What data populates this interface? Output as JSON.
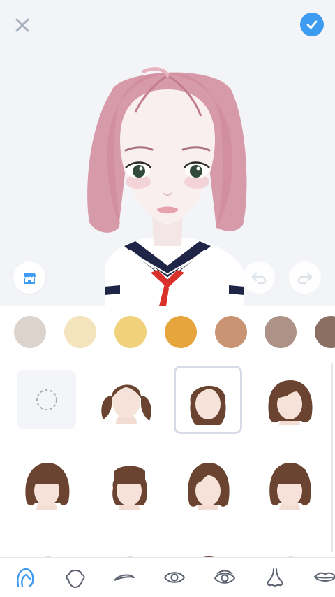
{
  "header": {
    "close_icon": "close-icon",
    "confirm_icon": "checkmark-icon",
    "confirm_color": "#3d9bf0"
  },
  "preview": {
    "store_icon": "store-icon",
    "undo_icon": "undo-icon",
    "redo_icon": "redo-icon",
    "hair_color": "#d79aa8"
  },
  "hair_colors": [
    "#dcd3cd",
    "#f3e4bd",
    "#f0d27c",
    "#e7a53d",
    "#c99473",
    "#ad9287",
    "#8c6f63"
  ],
  "hair_styles": [
    {
      "name": "none",
      "icon": "empty-circle-icon"
    },
    {
      "name": "pigtails",
      "selected": false
    },
    {
      "name": "wavy-bob",
      "selected": true
    },
    {
      "name": "side-part-bob",
      "selected": false
    },
    {
      "name": "bangs-ponytail",
      "selected": false
    },
    {
      "name": "bangs-bob",
      "selected": false
    },
    {
      "name": "sleek-bob",
      "selected": false
    },
    {
      "name": "blunt-bangs-bob",
      "selected": false
    }
  ],
  "hair_swatch_color": "#6a4430",
  "tabs": [
    {
      "icon": "hair-icon",
      "active": true
    },
    {
      "icon": "face-shape-icon",
      "active": false
    },
    {
      "icon": "eyebrow-icon",
      "active": false
    },
    {
      "icon": "eye-icon",
      "active": false
    },
    {
      "icon": "eye-detail-icon",
      "active": false
    },
    {
      "icon": "nose-icon",
      "active": false
    },
    {
      "icon": "lips-icon",
      "active": false
    }
  ],
  "active_color": "#3d9bf0",
  "inactive_color": "#5c6270"
}
